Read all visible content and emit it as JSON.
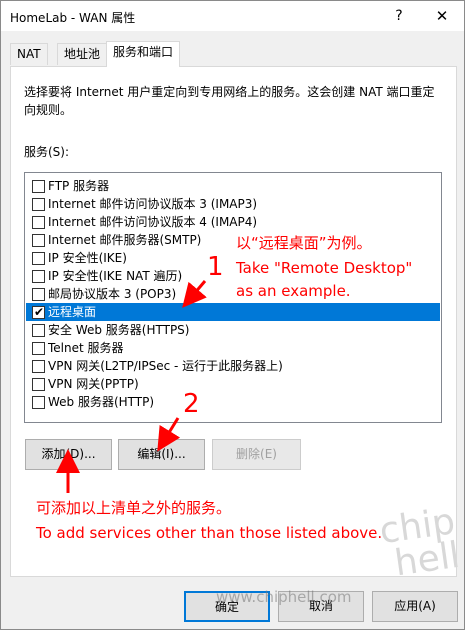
{
  "window": {
    "title": "HomeLab - WAN 属性",
    "help_label": "?",
    "close_label": "✕"
  },
  "tabs": [
    {
      "label": "NAT"
    },
    {
      "label": "地址池"
    },
    {
      "label": "服务和端口",
      "active": true
    }
  ],
  "description": "选择要将 Internet 用户重定向到专用网络上的服务。这会创建 NAT 端口重定向规则。",
  "services_label": "服务(S):",
  "services": [
    {
      "label": "FTP 服务器",
      "checked": false
    },
    {
      "label": "Internet 邮件访问协议版本 3 (IMAP3)",
      "checked": false
    },
    {
      "label": "Internet 邮件访问协议版本 4 (IMAP4)",
      "checked": false
    },
    {
      "label": "Internet 邮件服务器(SMTP)",
      "checked": false
    },
    {
      "label": "IP 安全性(IKE)",
      "checked": false
    },
    {
      "label": "IP 安全性(IKE NAT 遍历)",
      "checked": false
    },
    {
      "label": "邮局协议版本 3 (POP3)",
      "checked": false
    },
    {
      "label": "远程桌面",
      "checked": true,
      "selected": true
    },
    {
      "label": "安全 Web 服务器(HTTPS)",
      "checked": false
    },
    {
      "label": "Telnet 服务器",
      "checked": false
    },
    {
      "label": "VPN 网关(L2TP/IPSec - 运行于此服务器上)",
      "checked": false
    },
    {
      "label": "VPN 网关(PPTP)",
      "checked": false
    },
    {
      "label": "Web 服务器(HTTP)",
      "checked": false
    }
  ],
  "buttons": {
    "add": "添加(D)...",
    "edit": "编辑(I)...",
    "delete": "删除(E)",
    "ok": "确定",
    "cancel": "取消",
    "apply": "应用(A)"
  },
  "annotations": {
    "num1": "1",
    "num2": "2",
    "remote_cn": "以“远程桌面”为例。",
    "remote_en1": "Take \"Remote Desktop\"",
    "remote_en2": "as an example.",
    "add_cn": "可添加以上清单之外的服务。",
    "add_en": "To add services other than those listed above."
  },
  "watermark": {
    "logo_text": "chip hell",
    "url": "www.chiphell.com"
  },
  "colors": {
    "selection": "#0078d7",
    "annotation": "#ff0000"
  }
}
